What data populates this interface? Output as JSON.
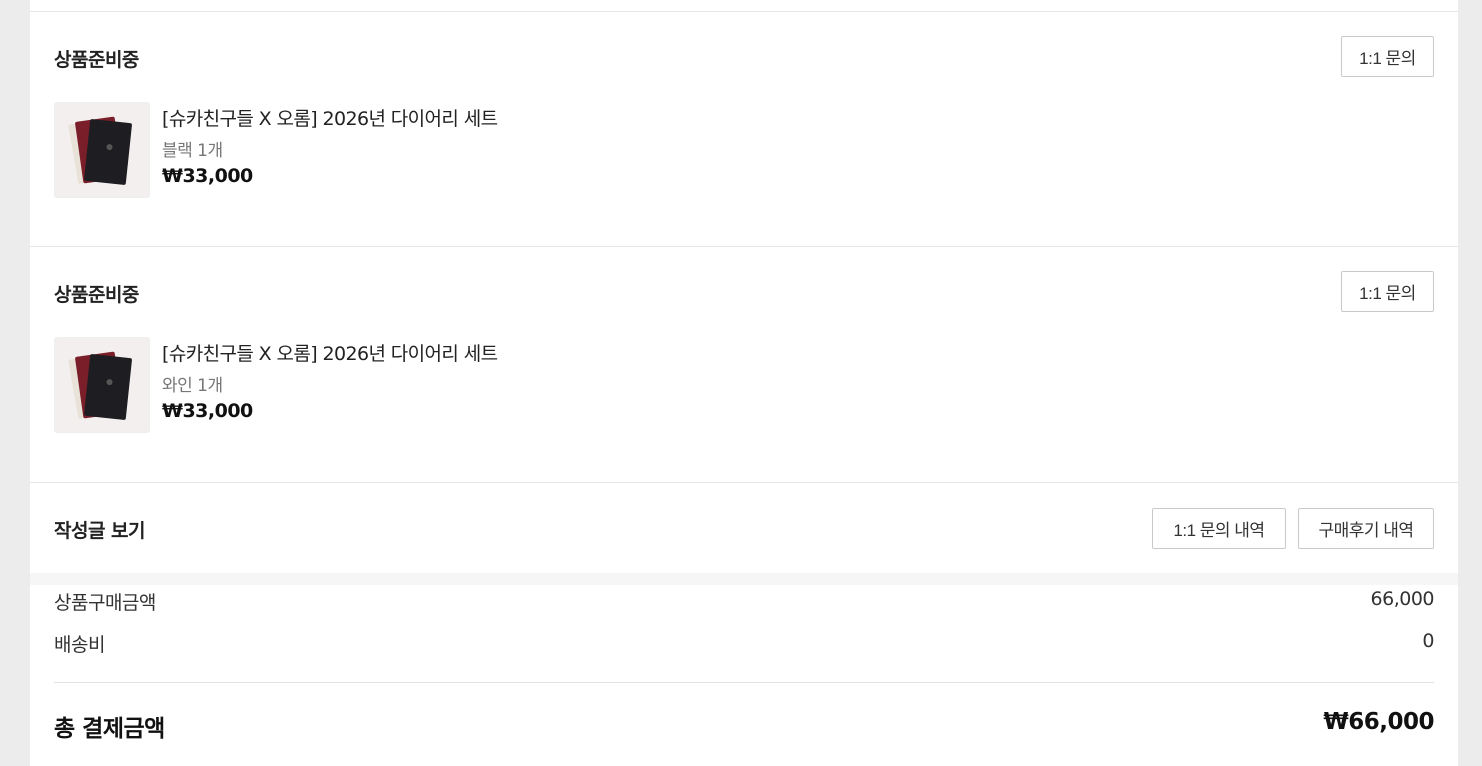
{
  "orders": [
    {
      "status": "상품준비중",
      "inquiry_label": "1:1 문의",
      "product_name": "[슈카친구들 X 오롬] 2026년 다이어리 세트",
      "option": "블랙 1개",
      "price": "₩33,000",
      "thumb_icon": "diary-set-thumbnail"
    },
    {
      "status": "상품준비중",
      "inquiry_label": "1:1 문의",
      "product_name": "[슈카친구들 X 오롬] 2026년 다이어리 세트",
      "option": "와인 1개",
      "price": "₩33,000",
      "thumb_icon": "diary-set-thumbnail"
    }
  ],
  "posts": {
    "title": "작성글 보기",
    "inquiry_history_label": "1:1 문의 내역",
    "review_history_label": "구매후기 내역"
  },
  "summary": {
    "goods_label": "상품구매금액",
    "goods_value": "66,000",
    "shipping_label": "배송비",
    "shipping_value": "0",
    "total_label": "총 결제금액",
    "total_value": "₩66,000"
  },
  "colors": {
    "background": "#ececec",
    "panel": "#ffffff",
    "border": "#c9c9c9"
  }
}
